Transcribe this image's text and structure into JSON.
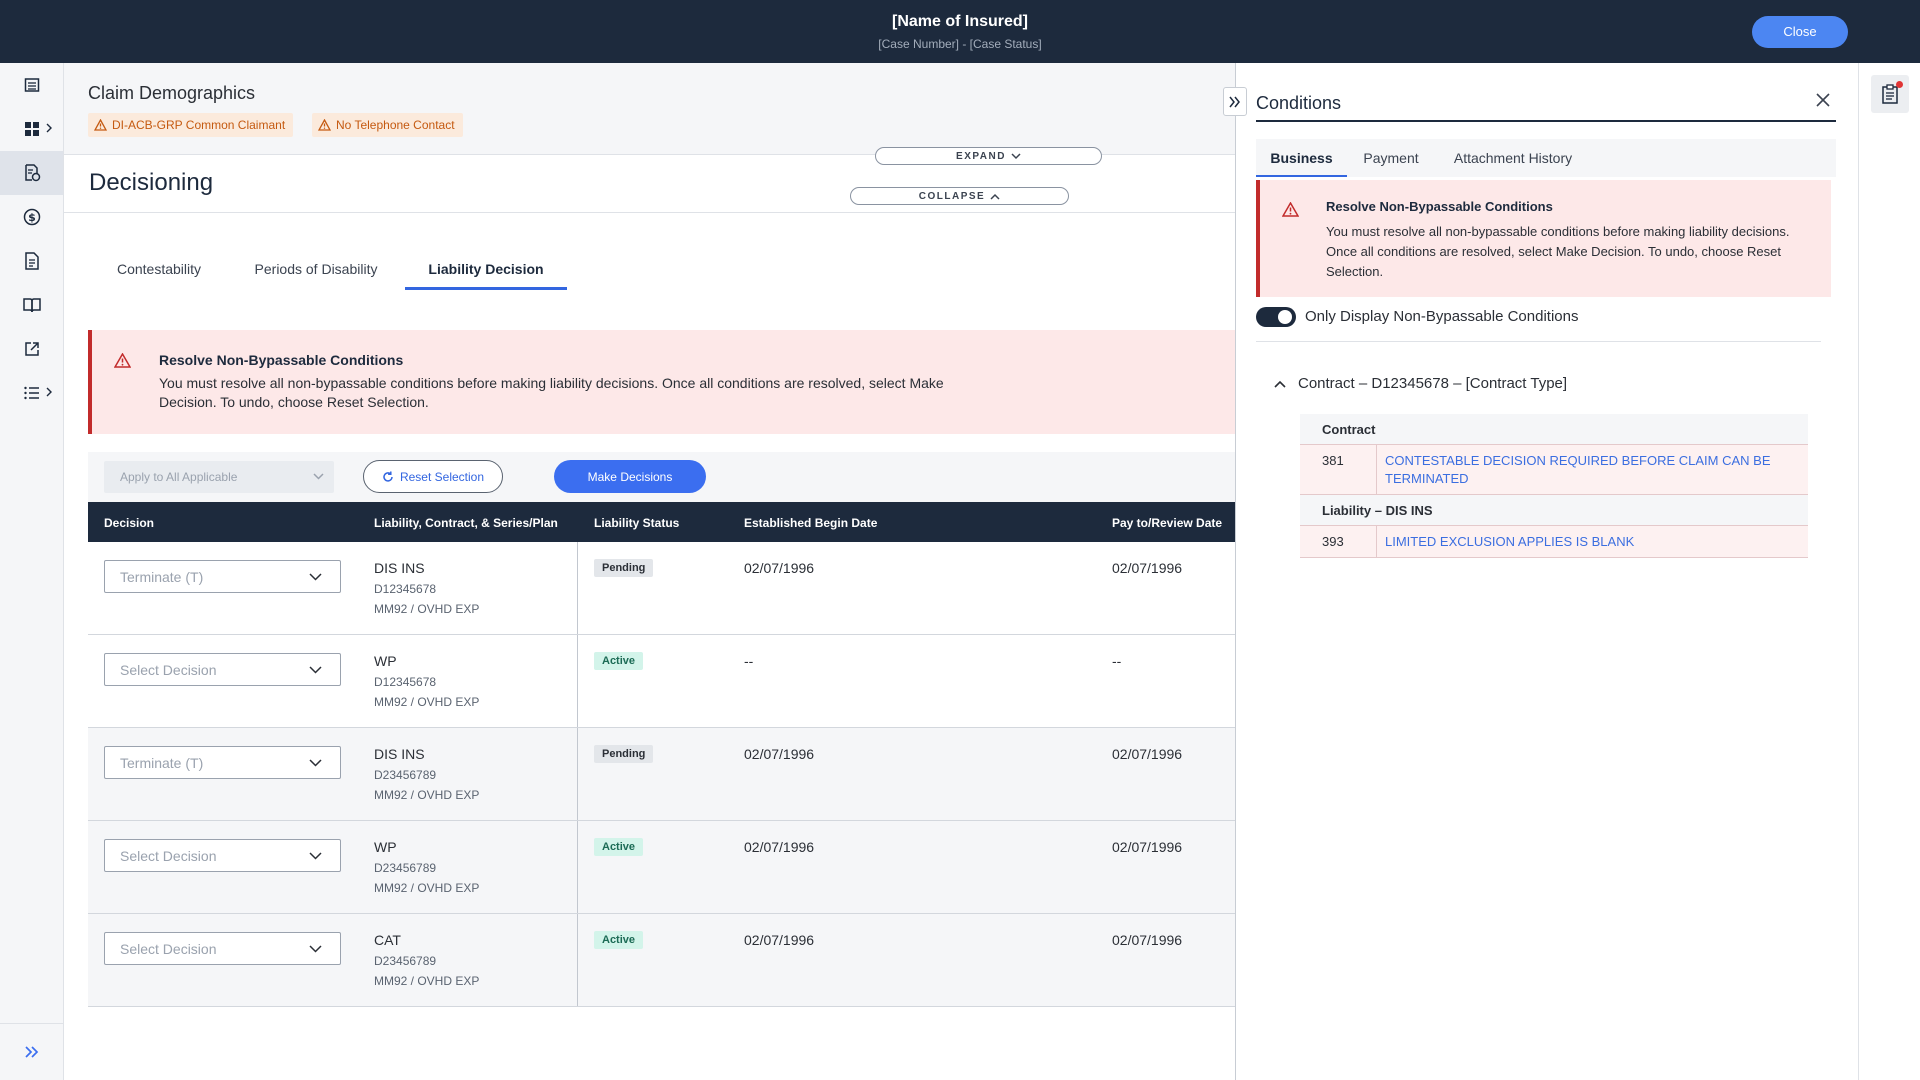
{
  "header": {
    "title": "[Name of Insured]",
    "subtitle": "[Case Number] - [Case Status]",
    "close_label": "Close"
  },
  "left_rail": {
    "items": [
      "list-icon",
      "dashboard-icon",
      "claim-document-icon",
      "dollar-icon",
      "document-icon",
      "book-icon",
      "external-link-icon",
      "menu-list-icon"
    ],
    "active": "claim-document-icon",
    "bottom": "double-chevron-right-icon"
  },
  "demographics": {
    "title": "Claim Demographics",
    "tags": [
      "DI-ACB-GRP Common Claimant",
      "No Telephone Contact"
    ],
    "expand_label": "EXPAND",
    "collapse_label": "COLLAPSE"
  },
  "decisioning": {
    "title": "Decisioning",
    "tabs": [
      "Contestability",
      "Periods of Disability",
      "Liability Decision"
    ],
    "active_tab": "Liability Decision",
    "alert": {
      "title": "Resolve Non-Bypassable Conditions",
      "text": "You must resolve all non-bypassable conditions before making liability decisions. Once all conditions are resolved, select Make Decision. To undo, choose Reset Selection."
    },
    "toolbar": {
      "apply_placeholder": "Apply to All Applicable",
      "reset_label": "Reset Selection",
      "make_label": "Make Decisions"
    },
    "table": {
      "columns": [
        "Decision",
        "Liability, Contract, & Series/Plan",
        "Liability Status",
        "Established Begin Date",
        "Pay to/Review Date"
      ],
      "rows": [
        {
          "decision": "Terminate (T)",
          "liability": "DIS INS",
          "contract": "D12345678",
          "plan": "MM92 / OVHD EXP",
          "status": "Pending",
          "begin": "02/07/1996",
          "pay": "02/07/1996"
        },
        {
          "decision": "Select Decision",
          "liability": "WP",
          "contract": "D12345678",
          "plan": "MM92 / OVHD EXP",
          "status": "Active",
          "begin": "--",
          "pay": "--"
        },
        {
          "decision": "Terminate (T)",
          "liability": "DIS INS",
          "contract": "D23456789",
          "plan": "MM92 / OVHD EXP",
          "status": "Pending",
          "begin": "02/07/1996",
          "pay": "02/07/1996"
        },
        {
          "decision": "Select Decision",
          "liability": "WP",
          "contract": "D23456789",
          "plan": "MM92 / OVHD EXP",
          "status": "Active",
          "begin": "02/07/1996",
          "pay": "02/07/1996"
        },
        {
          "decision": "Select Decision",
          "liability": "CAT",
          "contract": "D23456789",
          "plan": "MM92 / OVHD EXP",
          "status": "Active",
          "begin": "02/07/1996",
          "pay": "02/07/1996"
        }
      ]
    }
  },
  "conditions": {
    "title": "Conditions",
    "tabs": [
      "Business",
      "Payment",
      "Attachment History"
    ],
    "active_tab": "Business",
    "alert": {
      "title": "Resolve Non-Bypassable Conditions",
      "text": "You must resolve all non-bypassable conditions before making liability decisions. Once all conditions are resolved, select Make Decision. To undo, choose Reset Selection."
    },
    "toggle_label": "Only Display Non-Bypassable Conditions",
    "toggle_on": true,
    "contract_heading": "Contract – D12345678 – [Contract Type]",
    "groups": [
      {
        "label": "Contract",
        "items": [
          {
            "code": "381",
            "text": "CONTESTABLE DECISION REQUIRED BEFORE CLAIM CAN BE TERMINATED"
          }
        ]
      },
      {
        "label": "Liability – DIS INS",
        "items": [
          {
            "code": "393",
            "text": "LIMITED EXCLUSION APPLIES IS BLANK"
          }
        ]
      }
    ]
  },
  "colors": {
    "header_bg": "#1d2a3d",
    "accent": "#3b6ef0",
    "alert_bg": "#fde8e8",
    "alert_border": "#c22b2b",
    "pending_badge": "#e3e6ea",
    "active_badge": "#d3f4ea"
  }
}
